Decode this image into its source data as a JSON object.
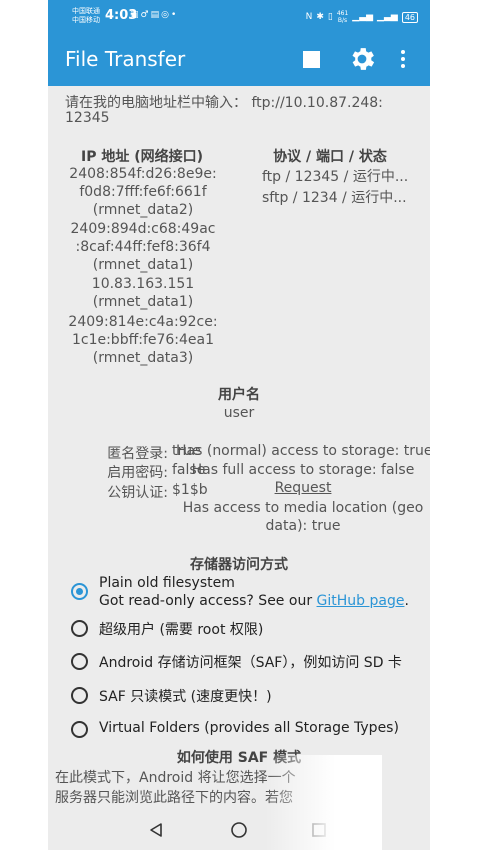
{
  "status_bar": {
    "carrier1": "中国联通",
    "carrier2": "中国移动",
    "time": "4:03",
    "net_speed_value": "461",
    "net_speed_unit": "B/s",
    "battery": "46"
  },
  "app_bar": {
    "title": "File Transfer",
    "actions": [
      "stop-icon",
      "gear-icon",
      "more-vert-icon"
    ]
  },
  "main": {
    "instruction_line1": "请在我的电脑地址栏中输入： ftp://10.10.87.248:",
    "instruction_line2": "12345",
    "ip_header": "IP 地址 (网络接口)",
    "protocol_header": "协议 / 端口 / 状态",
    "ip_lines": [
      "2408:854f:d26:8e9e:",
      "f0d8:7fff:fe6f:661f",
      "(rmnet_data2)",
      "2409:894d:c68:49ac",
      ":8caf:44ff:fef8:36f4",
      "(rmnet_data1)",
      "10.83.163.151",
      "(rmnet_data1)",
      "2409:814e:c4a:92ce:",
      "1c1e:bbff:fe76:4ea1",
      "(rmnet_data3)"
    ],
    "protocols": [
      "ftp / 12345 / 运行中...",
      "sftp / 1234 / 运行中..."
    ],
    "username_header": "用户名",
    "username": "user",
    "settings": [
      {
        "label": "匿名登录:",
        "value": "true"
      },
      {
        "label": "启用密码:",
        "value": "false"
      },
      {
        "label": "公钥认证:",
        "value": "$1$b"
      }
    ],
    "access_lines": [
      "Has (normal) access to storage: true",
      "Has full access to storage: false",
      "Request",
      "Has access to media location (geo",
      "data): true"
    ],
    "storage_header": "存储器访问方式",
    "storage_options": [
      {
        "label": "Plain old filesystem",
        "selected": true
      },
      {
        "label": "超级用户 (需要 root 权限)",
        "selected": false
      },
      {
        "label": "Android 存储访问框架（SAF），例如访问 SD 卡",
        "selected": false
      },
      {
        "label": "SAF 只读模式 (速度更快！)",
        "selected": false
      },
      {
        "label": "Virtual Folders (provides all Storage Types)",
        "selected": false
      }
    ],
    "option1_sub_text": "Got read-only access? See our ",
    "option1_sub_link": "GitHub page",
    "option1_sub_end": ".",
    "saf_header": "如何使用 SAF 模式",
    "saf_text_line1": "在此模式下，Android 将让您选择一个",
    "saf_text_line2": "服务器只能浏览此路径下的内容。若您"
  },
  "colors": {
    "accent": "#2b95d6",
    "background": "#ececec"
  }
}
